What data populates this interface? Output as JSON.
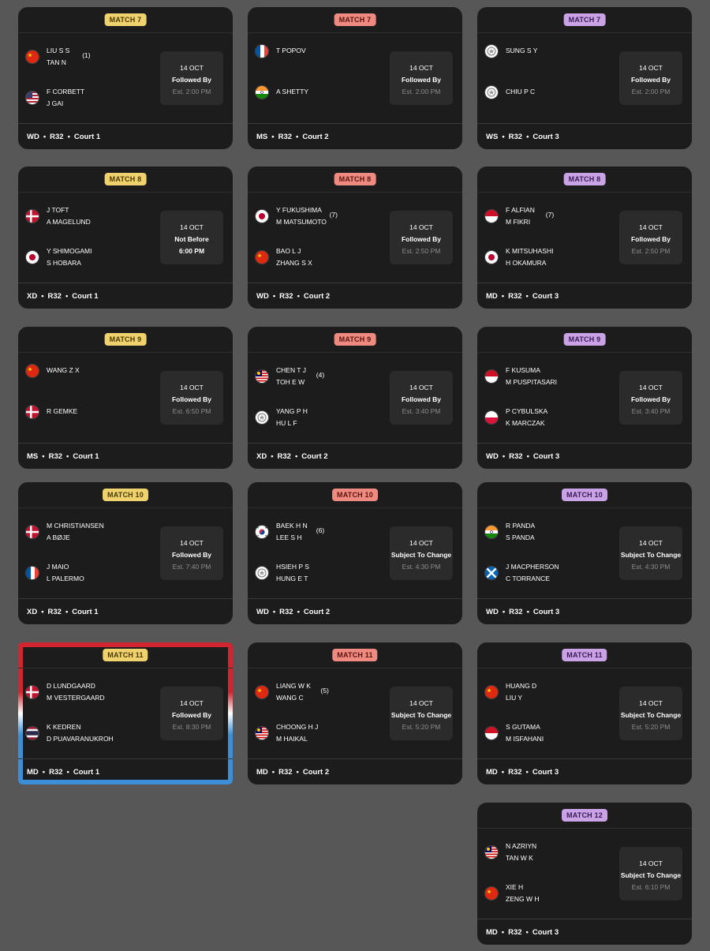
{
  "colors": {
    "page_bg": "#575757",
    "card_bg": "#1c1c1c",
    "court1_badge": "#efd26d",
    "court2_badge": "#ef8a80",
    "court3_badge": "#c9a3e6"
  },
  "cards": [
    {
      "badge": "MATCH 7",
      "court": 1,
      "t1": [
        "LIU S S",
        "TAN N"
      ],
      "t1_flag": "china-flag-icon",
      "t1_seed": "(1)",
      "t2": [
        "F CORBETT",
        "J GAI"
      ],
      "t2_flag": "usa-flag-icon",
      "t2_seed": "",
      "date": "14 OCT",
      "mid": "Followed By",
      "est": "Est. 2:00 PM",
      "footer": [
        "WD",
        "R32",
        "Court 1"
      ]
    },
    {
      "badge": "MATCH 7",
      "court": 2,
      "t1": [
        "T POPOV"
      ],
      "t1_flag": "france-flag-icon",
      "t1_seed": "",
      "t2": [
        "A SHETTY"
      ],
      "t2_flag": "india-flag-icon",
      "t2_seed": "",
      "date": "14 OCT",
      "mid": "Followed By",
      "est": "Est. 2:00 PM",
      "footer": [
        "MS",
        "R32",
        "Court 2"
      ]
    },
    {
      "badge": "MATCH 7",
      "court": 3,
      "t1": [
        "SUNG S Y"
      ],
      "t1_flag": "chinese-taipei-flag-icon",
      "t1_seed": "",
      "t2": [
        "CHIU P C"
      ],
      "t2_flag": "chinese-taipei-flag-icon",
      "t2_seed": "",
      "date": "14 OCT",
      "mid": "Followed By",
      "est": "Est. 2:00 PM",
      "footer": [
        "WS",
        "R32",
        "Court 3"
      ]
    },
    {
      "badge": "MATCH 8",
      "court": 1,
      "t1": [
        "J TOFT",
        "A MAGELUND"
      ],
      "t1_flag": "denmark-flag-icon",
      "t1_seed": "",
      "t2": [
        "Y SHIMOGAMI",
        "S HOBARA"
      ],
      "t2_flag": "japan-flag-icon",
      "t2_seed": "",
      "date": "14 OCT",
      "mid": "Not Before",
      "est": "6:00 PM",
      "est_white": true,
      "footer": [
        "XD",
        "R32",
        "Court 1"
      ]
    },
    {
      "badge": "MATCH 8",
      "court": 2,
      "t1": [
        "Y FUKUSHIMA",
        "M MATSUMOTO"
      ],
      "t1_flag": "japan-flag-icon",
      "t1_seed": "(7)",
      "t2": [
        "BAO L J",
        "ZHANG S X"
      ],
      "t2_flag": "china-flag-icon",
      "t2_seed": "",
      "date": "14 OCT",
      "mid": "Followed By",
      "est": "Est. 2:50 PM",
      "footer": [
        "WD",
        "R32",
        "Court 2"
      ]
    },
    {
      "badge": "MATCH 8",
      "court": 3,
      "t1": [
        "F ALFIAN",
        "M FIKRI"
      ],
      "t1_flag": "indonesia-flag-icon",
      "t1_seed": "(7)",
      "t2": [
        "K MITSUHASHI",
        "H OKAMURA"
      ],
      "t2_flag": "japan-flag-icon",
      "t2_seed": "",
      "date": "14 OCT",
      "mid": "Followed By",
      "est": "Est. 2:50 PM",
      "footer": [
        "MD",
        "R32",
        "Court 3"
      ]
    },
    {
      "badge": "MATCH 9",
      "court": 1,
      "t1": [
        "WANG Z X"
      ],
      "t1_flag": "china-flag-icon",
      "t1_seed": "",
      "t2": [
        "R GEMKE"
      ],
      "t2_flag": "denmark-flag-icon",
      "t2_seed": "",
      "date": "14 OCT",
      "mid": "Followed By",
      "est": "Est. 6:50 PM",
      "footer": [
        "MS",
        "R32",
        "Court 1"
      ]
    },
    {
      "badge": "MATCH 9",
      "court": 2,
      "t1": [
        "CHEN T J",
        "TOH E W"
      ],
      "t1_flag": "malaysia-flag-icon",
      "t1_seed": "(4)",
      "t2": [
        "YANG P H",
        "HU L F"
      ],
      "t2_flag": "chinese-taipei-flag-icon",
      "t2_seed": "",
      "date": "14 OCT",
      "mid": "Followed By",
      "est": "Est. 3:40 PM",
      "footer": [
        "XD",
        "R32",
        "Court 2"
      ]
    },
    {
      "badge": "MATCH 9",
      "court": 3,
      "t1": [
        "F KUSUMA",
        "M PUSPITASARI"
      ],
      "t1_flag": "indonesia-flag-icon",
      "t1_seed": "",
      "t2": [
        "P CYBULSKA",
        "K MARCZAK"
      ],
      "t2_flag": "poland-flag-icon",
      "t2_seed": "",
      "date": "14 OCT",
      "mid": "Followed By",
      "est": "Est. 3:40 PM",
      "footer": [
        "WD",
        "R32",
        "Court 3"
      ]
    },
    {
      "badge": "MATCH 10",
      "court": 1,
      "t1": [
        "M CHRISTIANSEN",
        "A BØJE"
      ],
      "t1_flag": "denmark-flag-icon",
      "t1_seed": "",
      "t2": [
        "J MAIO",
        "L PALERMO"
      ],
      "t2_flag": "france-flag-icon",
      "t2_seed": "",
      "date": "14 OCT",
      "mid": "Followed By",
      "est": "Est. 7:40 PM",
      "footer": [
        "XD",
        "R32",
        "Court 1"
      ]
    },
    {
      "badge": "MATCH 10",
      "court": 2,
      "t1": [
        "BAEK H N",
        "LEE S H"
      ],
      "t1_flag": "korea-flag-icon",
      "t1_seed": "(6)",
      "t2": [
        "HSIEH P S",
        "HUNG E T"
      ],
      "t2_flag": "chinese-taipei-flag-icon",
      "t2_seed": "",
      "date": "14 OCT",
      "mid": "Subject To Change",
      "est": "Est. 4:30 PM",
      "footer": [
        "WD",
        "R32",
        "Court 2"
      ]
    },
    {
      "badge": "MATCH 10",
      "court": 3,
      "t1": [
        "R PANDA",
        "S PANDA"
      ],
      "t1_flag": "india-flag-icon",
      "t1_seed": "",
      "t2": [
        "J MACPHERSON",
        "C TORRANCE"
      ],
      "t2_flag": "scotland-flag-icon",
      "t2_seed": "",
      "date": "14 OCT",
      "mid": "Subject To Change",
      "est": "Est. 4:30 PM",
      "footer": [
        "WD",
        "R32",
        "Court 3"
      ]
    },
    {
      "badge": "MATCH 11",
      "court": 1,
      "active": true,
      "t1": [
        "D LUNDGAARD",
        "M VESTERGAARD"
      ],
      "t1_flag": "denmark-flag-icon",
      "t1_seed": "",
      "t2": [
        "K KEDREN",
        "D PUAVARANUKROH"
      ],
      "t2_flag": "thailand-flag-icon",
      "t2_seed": "",
      "date": "14 OCT",
      "mid": "Followed By",
      "est": "Est. 8:30 PM",
      "footer": [
        "MD",
        "R32",
        "Court 1"
      ]
    },
    {
      "badge": "MATCH 11",
      "court": 2,
      "t1": [
        "LIANG W K",
        "WANG C"
      ],
      "t1_flag": "china-flag-icon",
      "t1_seed": "(5)",
      "t2": [
        "CHOONG H J",
        "M HAIKAL"
      ],
      "t2_flag": "malaysia-flag-icon",
      "t2_seed": "",
      "date": "14 OCT",
      "mid": "Subject To Change",
      "est": "Est. 5:20 PM",
      "footer": [
        "MD",
        "R32",
        "Court 2"
      ]
    },
    {
      "badge": "MATCH 11",
      "court": 3,
      "t1": [
        "HUANG D",
        "LIU Y"
      ],
      "t1_flag": "china-flag-icon",
      "t1_seed": "",
      "t2": [
        "S GUTAMA",
        "M ISFAHANI"
      ],
      "t2_flag": "indonesia-flag-icon",
      "t2_seed": "",
      "date": "14 OCT",
      "mid": "Subject To Change",
      "est": "Est. 5:20 PM",
      "footer": [
        "MD",
        "R32",
        "Court 3"
      ]
    },
    {
      "badge": "MATCH 12",
      "court": 3,
      "t1": [
        "N AZRIYN",
        "TAN W K"
      ],
      "t1_flag": "malaysia-flag-icon",
      "t1_seed": "",
      "t2": [
        "XIE H",
        "ZENG W H"
      ],
      "t2_flag": "china-flag-icon",
      "t2_seed": "",
      "date": "14 OCT",
      "mid": "Subject To Change",
      "est": "Est. 6:10 PM",
      "footer": [
        "MD",
        "R32",
        "Court 3"
      ]
    }
  ]
}
